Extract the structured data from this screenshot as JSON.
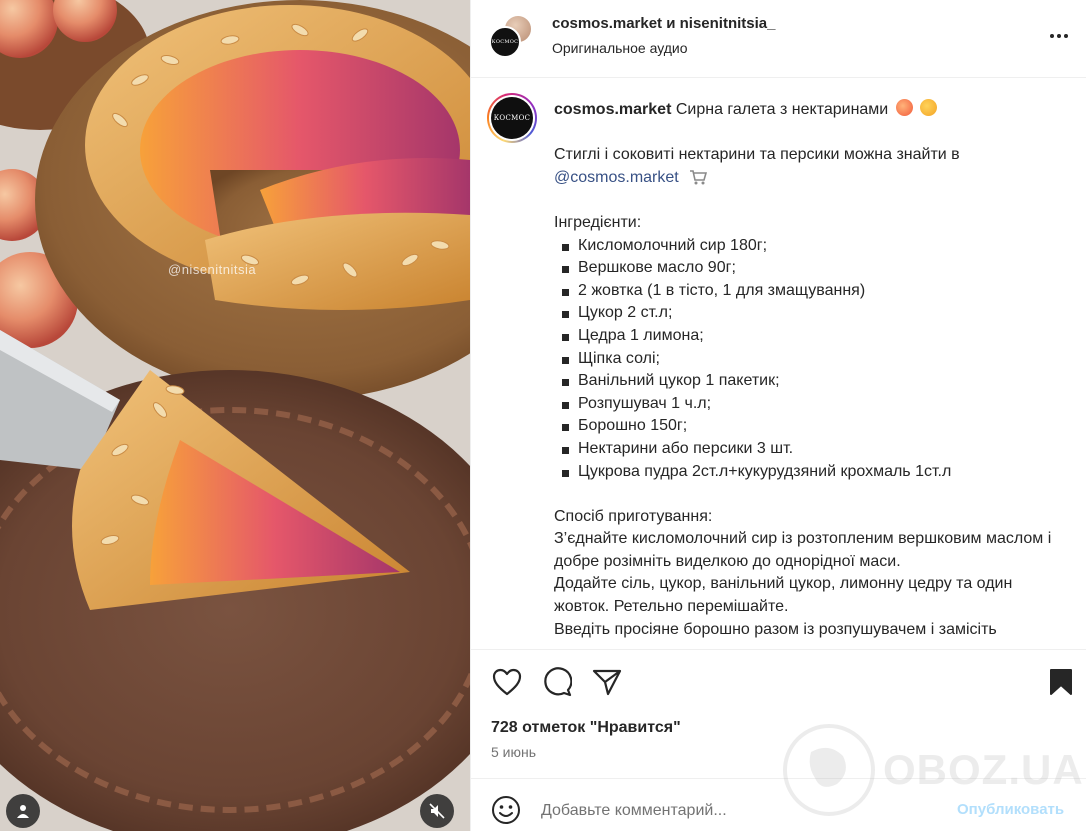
{
  "media": {
    "watermark_handle": "@nisenitnitsia",
    "mute_state": "muted"
  },
  "header": {
    "title": "cosmos.market и nisenitnitsia_",
    "audio": "Оригинальное аудио",
    "logo_text": "КОСМОС"
  },
  "caption": {
    "username": "cosmos.market",
    "headline": "Сирна галета з нектаринами",
    "intro": "Стиглі і соковиті нектарини та персики можна знайти в",
    "mention": "@cosmos.market",
    "ingredients_title": "Інгредієнти:",
    "ingredients": [
      "Кисломолочний сир 180г;",
      "Вершкове масло 90г;",
      "2 жовтка (1 в тісто, 1 для змащування)",
      "Цукор 2 ст.л;",
      "Цедра 1 лимона;",
      "Щіпка солі;",
      "Ванільний цукор 1 пакетик;",
      "Розпушувач 1 ч.л;",
      "Борошно 150г;",
      "Нектарини або персики 3 шт.",
      "Цукрова пудра 2ст.л+кукурудзяний крохмаль 1ст.л"
    ],
    "method_title": "Спосіб приготування:",
    "method": [
      "З’єднайте кисломолочний сир із розтопленим вершковим маслом і добре розімніть виделкою до однорідної маси.",
      "Додайте сіль, цукор, ванільний цукор, лимонну цедру та один жовток. Ретельно перемішайте.",
      "Введіть просіяне борошно разом із розпушувачем і замісіть"
    ]
  },
  "actions": {
    "likes": "728 отметок \"Нравится\"",
    "date": "5 июнь"
  },
  "comment": {
    "placeholder": "Добавьте комментарий...",
    "post_label": "Опубликовать"
  },
  "site_watermark": "OBOZ.UA",
  "colors": {
    "link": "#385185",
    "post_button_disabled": "#b2dffc",
    "muted_text": "#737373"
  }
}
